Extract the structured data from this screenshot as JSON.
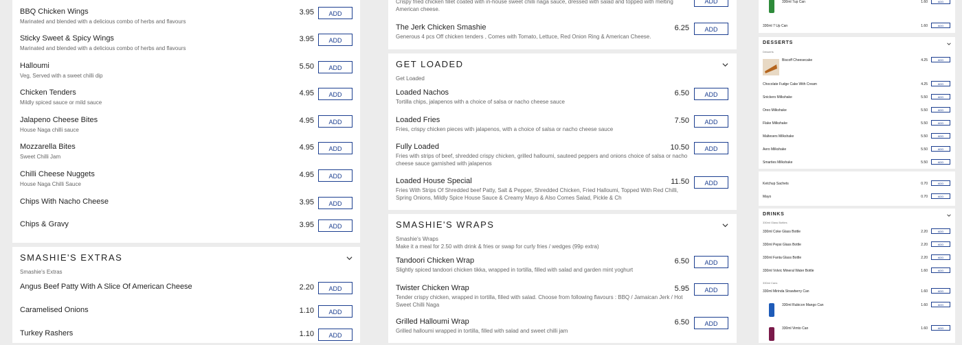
{
  "left": {
    "items": [
      {
        "name": "BBQ Chicken Wings",
        "desc": "Marinated and blended with a delicious combo of herbs and flavours",
        "price": "3.95"
      },
      {
        "name": "Sticky Sweet & Spicy Wings",
        "desc": "Marinated and blended with a delicious combo of herbs and flavours",
        "price": "3.95"
      },
      {
        "name": "Halloumi",
        "desc": "Veg, Served with a sweet chilli dip",
        "price": "5.50"
      },
      {
        "name": "Chicken Tenders",
        "desc": "Mildly spiced sauce or mild sauce",
        "price": "4.95"
      },
      {
        "name": "Jalapeno Cheese Bites",
        "desc": "House Naga chilli sauce",
        "price": "4.95"
      },
      {
        "name": "Mozzarella Bites",
        "desc": "Sweet Chilli Jam",
        "price": "4.95"
      },
      {
        "name": "Chilli Cheese Nuggets",
        "desc": "House Naga Chilli Sauce",
        "price": "4.95"
      },
      {
        "name": "Chips With Nacho Cheese",
        "desc": "",
        "price": "3.95"
      },
      {
        "name": "Chips & Gravy",
        "desc": "",
        "price": "3.95"
      }
    ],
    "extras": {
      "title": "SMASHIE'S EXTRAS",
      "subtitle": "Smashie's Extras",
      "items": [
        {
          "name": "Angus Beef Patty With A Slice Of American Cheese",
          "price": "2.20"
        },
        {
          "name": "Caramelised Onions",
          "price": "1.10"
        },
        {
          "name": "Turkey Rashers",
          "price": "1.10"
        }
      ]
    },
    "add_label": "ADD"
  },
  "middle": {
    "top_desc": "Crispy fried chicken fillet coated with in-house sweet chilli naga sauce, dressed with salad and topped with melting American cheese.",
    "jerk": {
      "name": "The Jerk Chicken Smashie",
      "desc": "Generous 4 pcs Off chicken tenders , Comes with Tomato, Lettuce, Red Onion Ring & American Cheese.",
      "price": "6.25"
    },
    "loaded": {
      "title": "GET LOADED",
      "subtitle": "Get Loaded",
      "items": [
        {
          "name": "Loaded Nachos",
          "desc": "Tortilla chips, jalapenos with a choice of salsa or nacho cheese sauce",
          "price": "6.50"
        },
        {
          "name": "Loaded Fries",
          "desc": "Fries, crispy chicken pieces with jalapenos, with a choice of salsa or nacho cheese sauce",
          "price": "7.50"
        },
        {
          "name": "Fully Loaded",
          "desc": "Fries with strips of beef, shredded crispy chicken, grilled halloumi, sauteed peppers and onions choice of salsa or nacho cheese sauce garnished with jalapenos",
          "price": "10.50"
        },
        {
          "name": "Loaded House Special",
          "desc": "Fries With Strips Of Shredded beef Patty, Salt & Pepper, Shredded Chicken, Fried Halloumi, Topped With Red Chilli, Spring Onions, Mildly Spice House Sauce & Creamy Mayo & Also Comes Salad, Pickle & Ch",
          "price": "11.50"
        }
      ]
    },
    "wraps": {
      "title": "SMASHIE'S WRAPS",
      "subtitle": "Smashie's Wraps",
      "subtitle2": "Make it a meal for 2.50 with drink & fries or swap for curly fries / wedges (99p extra)",
      "items": [
        {
          "name": "Tandoori Chicken Wrap",
          "desc": "Slightly spiced tandoori chicken tikka, wrapped in tortilla, filled with salad and garden mint yoghurt",
          "price": "6.50"
        },
        {
          "name": "Twister Chicken Wrap",
          "desc": "Tender crispy chicken, wrapped in tortilla, filled with salad. Choose from following flavours : BBQ / Jamaican Jerk / Hot Sweet Chilli Naga",
          "price": "5.95"
        },
        {
          "name": "Grilled Halloumi Wrap",
          "desc": "Grilled halloumi wrapped in tortilla, filled with salad and sweet chilli jam",
          "price": "6.50"
        }
      ]
    }
  },
  "right": {
    "top_items": [
      {
        "name": "330ml 7up Can",
        "price": "1.60"
      },
      {
        "name": "330ml 7 Up Can",
        "price": "1.60"
      }
    ],
    "desserts": {
      "title": "DESSERTS",
      "subtitle": "Desserts",
      "items": [
        {
          "name": "Biscoff Cheesecake",
          "price": "4.25"
        },
        {
          "name": "Chocolate Fudge Cake With Cream",
          "price": "4.25"
        },
        {
          "name": "Snickers Milkshake",
          "price": "5.50"
        },
        {
          "name": "Oreo Milkshake",
          "price": "5.50"
        },
        {
          "name": "Flake Milkshake",
          "price": "5.50"
        },
        {
          "name": "Maltesers Milkshake",
          "price": "5.50"
        },
        {
          "name": "Aero Milkshake",
          "price": "5.50"
        },
        {
          "name": "Smarties Milkshake",
          "price": "5.50"
        }
      ]
    },
    "sauces": [
      {
        "name": "Ketchup Sachets",
        "price": "0.70"
      },
      {
        "name": "Mayo",
        "price": "0.70"
      }
    ],
    "drinks": {
      "title": "DRINKS",
      "subtitle": "330ml Glass Bottles",
      "bottles": [
        {
          "name": "330ml Coke Glass Bottle",
          "price": "2.20"
        },
        {
          "name": "330ml Pepsi Glass Bottle",
          "price": "2.20"
        },
        {
          "name": "330ml Fanta Glass Bottle",
          "price": "2.20"
        },
        {
          "name": "330ml Volvic Mineral Water Bottle",
          "price": "1.60"
        }
      ],
      "cans_subtitle": "330ml Cans",
      "cans": [
        {
          "name": "330ml Mirinda Strawberry Can",
          "price": "1.60"
        },
        {
          "name": "330ml Rubicon Mango Can",
          "price": "1.60"
        },
        {
          "name": "330ml Vimto Can",
          "price": "1.60"
        }
      ]
    },
    "add_label": "ADD"
  },
  "colors": {
    "accent": "#1a3d8f",
    "background": "#ececec",
    "card": "#ffffff"
  }
}
